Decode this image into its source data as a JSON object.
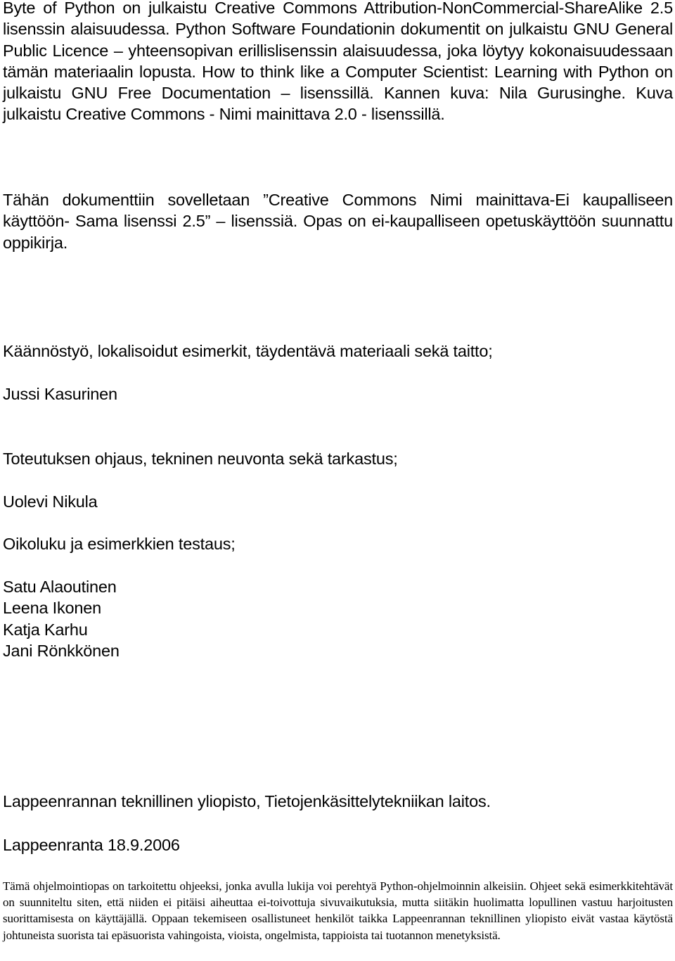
{
  "license_paragraph": "Byte of Python on julkaistu Creative Commons Attribution-NonCommercial-ShareAlike 2.5 lisenssin alaisuudessa. Python Software Foundationin dokumentit on julkaistu GNU General Public Licence – yhteensopivan erillislisenssin alaisuudessa, joka löytyy kokonaisuudessaan tämän materiaalin lopusta. How to think like a Computer Scientist: Learning with Python on julkaistu GNU Free Documentation – lisenssillä. Kannen kuva: Nila Gurusinghe. Kuva julkaistu Creative Commons - Nimi mainittava 2.0 - lisenssillä.",
  "applied_license_paragraph": "Tähän dokumenttiin sovelletaan ”Creative Commons Nimi mainittava-Ei kaupalliseen käyttöön- Sama lisenssi 2.5” – lisenssiä. Opas on ei-kaupalliseen opetuskäyttöön suunnattu oppikirja.",
  "credits": [
    {
      "role": "Käännöstyö, lokalisoidut esimerkit, täydentävä materiaali sekä taitto;",
      "names": [
        "Jussi Kasurinen"
      ]
    },
    {
      "role": "Toteutuksen ohjaus, tekninen neuvonta sekä tarkastus;",
      "names": [
        "Uolevi Nikula"
      ]
    },
    {
      "role": "Oikoluku ja esimerkkien testaus;",
      "names": [
        "Satu Alaoutinen",
        "Leena Ikonen",
        "Katja Karhu",
        "Jani Rönkkönen"
      ]
    }
  ],
  "institution": "Lappeenrannan teknillinen yliopisto, Tietojenkäsittelytekniikan laitos.",
  "place_date": "Lappeenranta 18.9.2006",
  "disclaimer": "Tämä ohjelmointiopas on tarkoitettu ohjeeksi, jonka avulla lukija voi perehtyä Python-ohjelmoinnin alkeisiin. Ohjeet sekä esimerkkitehtävät on suunniteltu siten, että niiden ei pitäisi aiheuttaa ei-toivottuja sivuvaikutuksia, mutta siitäkin huolimatta lopullinen vastuu harjoitusten suorittamisesta on käyttäjällä. Oppaan tekemiseen osallistuneet henkilöt taikka Lappeenrannan teknillinen yliopisto eivät vastaa käytöstä johtuneista suorista tai epäsuorista vahingoista, vioista, ongelmista, tappioista tai tuotannon menetyksistä."
}
